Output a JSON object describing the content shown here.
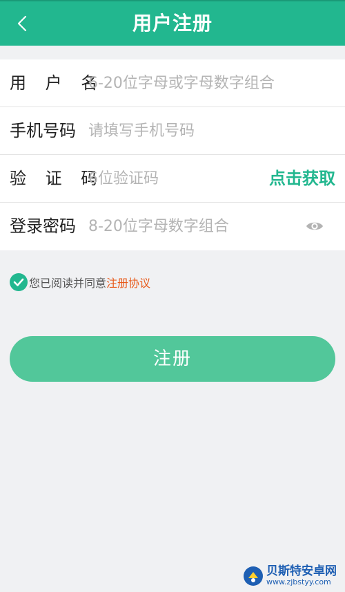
{
  "header": {
    "title": "用户注册",
    "back_icon": "chevron-left-icon",
    "background": "#22b78f"
  },
  "form": {
    "username": {
      "label": "用 户 名",
      "placeholder": "6-20位字母或字母数字组合",
      "value": ""
    },
    "phone": {
      "label": "手机号码",
      "placeholder": "请填写手机号码",
      "value": ""
    },
    "code": {
      "label": "验 证 码",
      "placeholder": "6位验证码",
      "value": "",
      "action_label": "点击获取"
    },
    "password": {
      "label": "登录密码",
      "placeholder": "8-20位字母数字组合",
      "value": "",
      "toggle_icon": "eye-icon"
    }
  },
  "agreement": {
    "checked": true,
    "text": "您已阅读并同意",
    "link_text": "注册协议",
    "link_color": "#e85a1a"
  },
  "submit": {
    "label": "注册",
    "color": "#52c79a"
  },
  "watermark": {
    "name": "贝斯特安卓网",
    "url": "www.zjbstyy.com"
  }
}
